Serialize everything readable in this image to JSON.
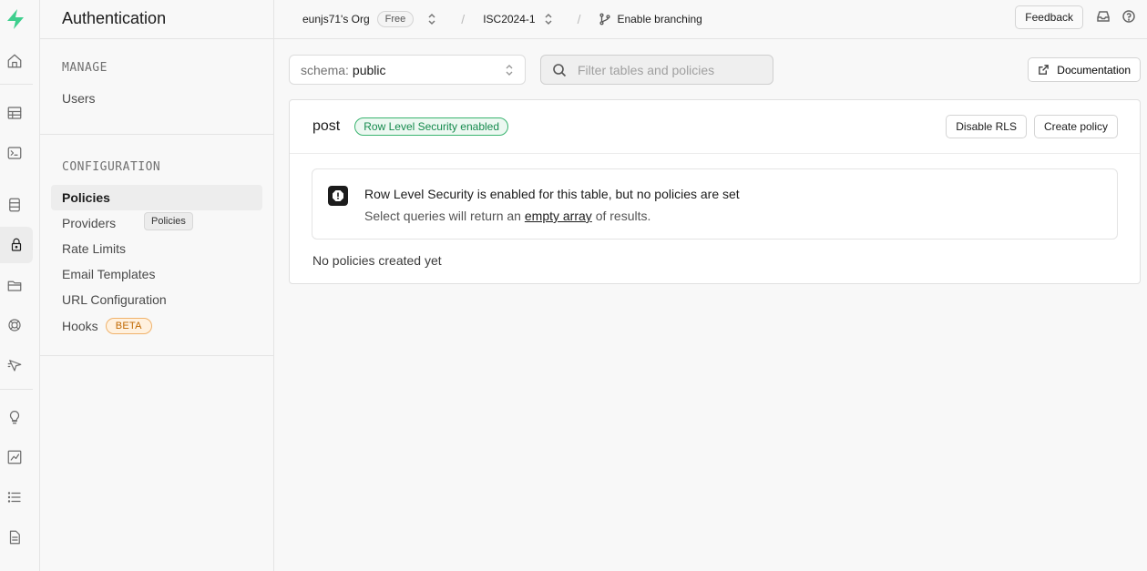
{
  "sidebar": {
    "title": "Authentication",
    "manage_heading": "MANAGE",
    "manage_items": [
      {
        "label": "Users"
      }
    ],
    "config_heading": "CONFIGURATION",
    "config_items": [
      {
        "label": "Policies",
        "selected": true
      },
      {
        "label": "Providers"
      },
      {
        "label": "Rate Limits"
      },
      {
        "label": "Email Templates"
      },
      {
        "label": "URL Configuration"
      },
      {
        "label": "Hooks",
        "badge": "BETA"
      }
    ],
    "tooltip": "Policies"
  },
  "topbar": {
    "org": "eunjs71's Org",
    "plan": "Free",
    "project": "ISC2024-1",
    "branching": "Enable branching",
    "feedback": "Feedback"
  },
  "main": {
    "schema_label": "schema:",
    "schema_value": "public",
    "filter_placeholder": "Filter tables and policies",
    "documentation": "Documentation",
    "table": {
      "name": "post",
      "rls_badge": "Row Level Security enabled",
      "disable_rls": "Disable RLS",
      "create_policy": "Create policy",
      "alert_title": "Row Level Security is enabled for this table, but no policies are set",
      "alert_desc_before": "Select queries will return an",
      "alert_desc_link": "empty array",
      "alert_desc_after": "of results.",
      "empty_text": "No policies created yet"
    }
  },
  "colors": {
    "brand": "#3ecf8e",
    "rls_green": "#158a4d",
    "beta_orange": "#c06800"
  },
  "rail_icons": [
    "supabase-logo-icon",
    "home-icon",
    "table-editor-icon",
    "sql-editor-icon",
    "database-icon",
    "authentication-icon",
    "storage-icon",
    "realtime-icon",
    "edge-functions-icon",
    "advisors-icon",
    "reports-icon",
    "logs-icon",
    "api-docs-icon"
  ]
}
